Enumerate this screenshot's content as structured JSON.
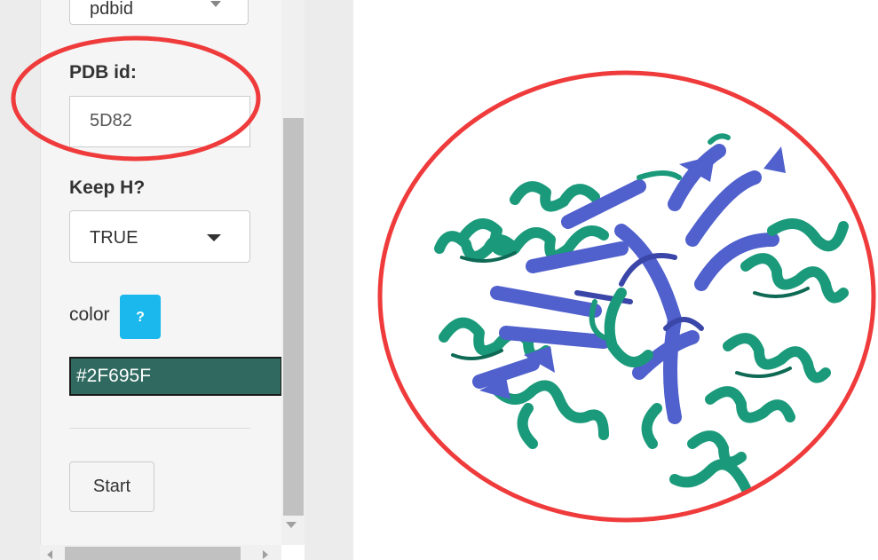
{
  "sidebar": {
    "source_select_value": "pdbid",
    "pdb_label": "PDB id:",
    "pdb_value": "5D82",
    "keep_h_label": "Keep H?",
    "keep_h_value": "TRUE",
    "color_label": "color",
    "help_icon_text": "?",
    "color_value": "#2F695F",
    "start_label": "Start"
  },
  "viewer": {
    "chain_colors": [
      "#5060cc",
      "#1a9a7a"
    ],
    "annotation_color": "#ef3b3b"
  }
}
